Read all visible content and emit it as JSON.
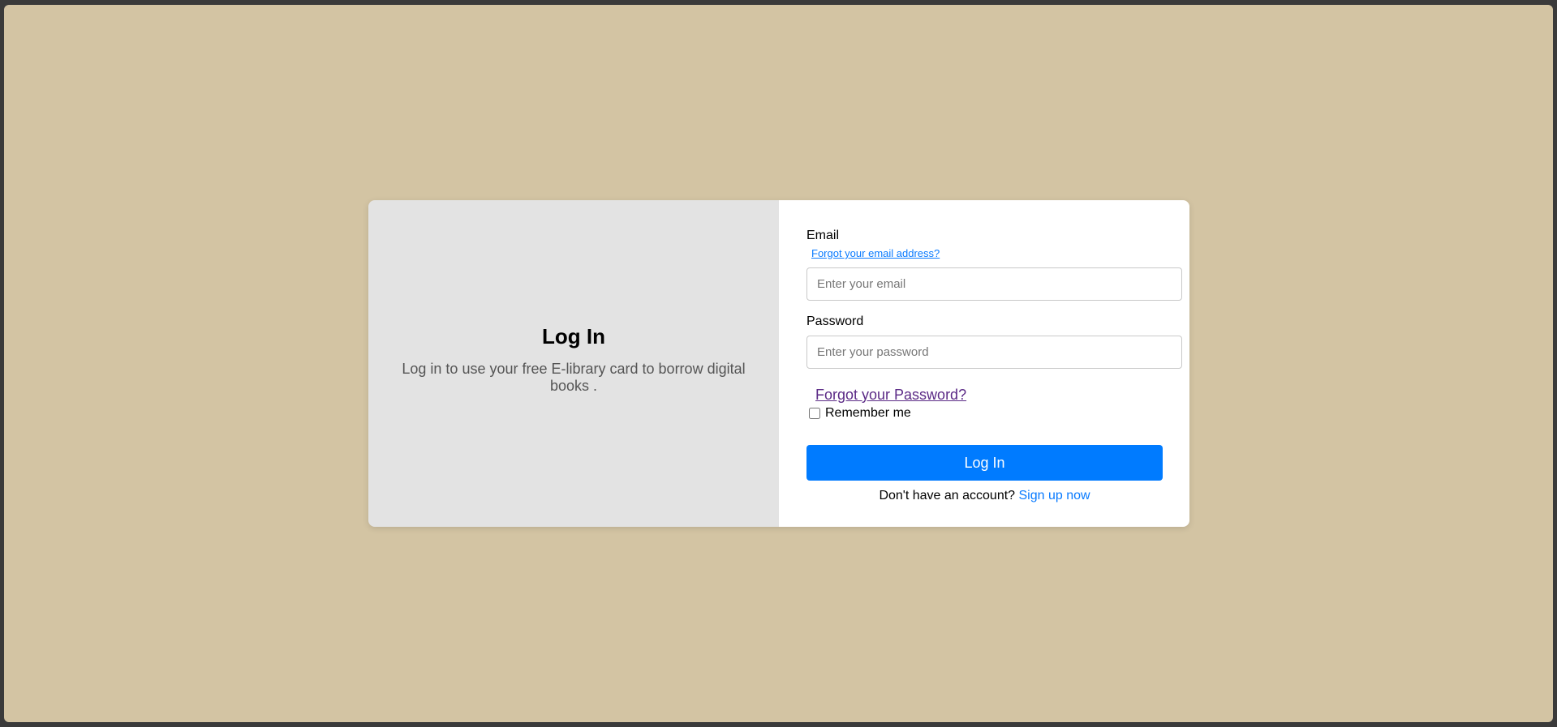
{
  "left": {
    "title": "Log In",
    "subtitle": "Log in to use your free E-library card to borrow digital books ."
  },
  "form": {
    "email_label": "Email",
    "forgot_email_link": "Forgot your email address?",
    "email_value": "",
    "email_placeholder": "Enter your email",
    "password_label": "Password",
    "password_value": "",
    "password_placeholder": "Enter your password",
    "forgot_password_link": "Forgot your Password?",
    "remember_label": "Remember me",
    "remember_checked": false,
    "login_button": "Log In",
    "no_account_text": "Don't have an account?",
    "signup_link": "Sign up now"
  },
  "colors": {
    "page_background": "#d3c4a3",
    "left_panel": "#e3e3e3",
    "primary": "#007bff",
    "visited_link": "#5b2a86"
  }
}
